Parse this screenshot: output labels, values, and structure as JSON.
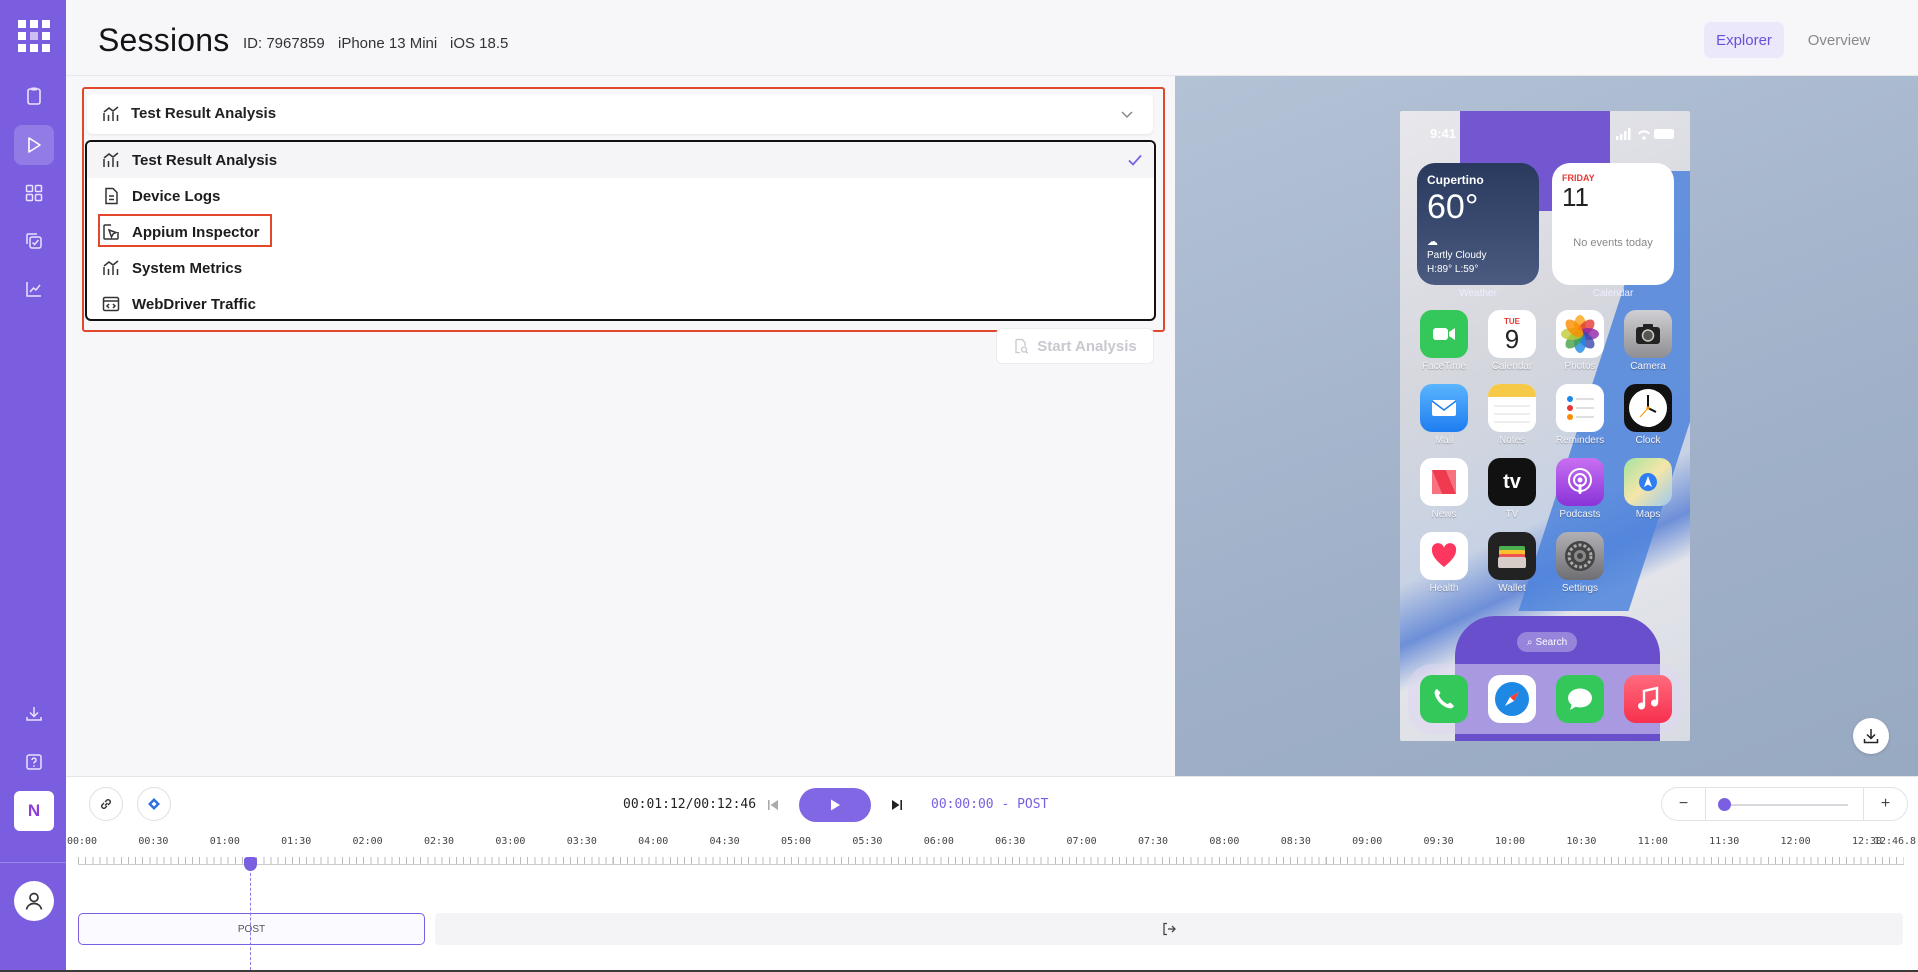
{
  "header": {
    "title": "Sessions",
    "id_text": "ID: 7967859",
    "device": "iPhone 13 Mini",
    "os": "iOS 18.5",
    "tabs": [
      "Explorer",
      "Overview"
    ],
    "active_tab": "Explorer"
  },
  "sidebar": {
    "items": [
      "clipboard-icon",
      "play-icon",
      "grid-icon",
      "copy-check-icon",
      "chart-icon",
      "download-icon",
      "help-icon"
    ],
    "active": "play-icon",
    "workspace_initial": "N"
  },
  "analysis": {
    "selected": "Test Result Analysis",
    "options": [
      {
        "label": "Test Result Analysis",
        "icon": "chart-up-icon",
        "selected": true
      },
      {
        "label": "Device Logs",
        "icon": "document-icon",
        "selected": false
      },
      {
        "label": "Appium Inspector",
        "icon": "cursor-select-icon",
        "selected": false
      },
      {
        "label": "System Metrics",
        "icon": "chart-up-icon",
        "selected": false
      },
      {
        "label": "WebDriver Traffic",
        "icon": "browser-code-icon",
        "selected": false
      }
    ],
    "start_button": "Start Analysis"
  },
  "device_screen": {
    "status_time": "9:41",
    "weather": {
      "city": "Cupertino",
      "temp": "60°",
      "condition": "Partly Cloudy",
      "range": "H:89° L:59°",
      "label": "Weather"
    },
    "calendar_widget": {
      "day": "FRIDAY",
      "date": "11",
      "events": "No events today",
      "label": "Calendar"
    },
    "apps": [
      {
        "name": "FaceTime",
        "color": "#34c759"
      },
      {
        "name": "Calendar",
        "color": "#ffffff"
      },
      {
        "name": "Photos",
        "color": "#ffffff"
      },
      {
        "name": "Camera",
        "color": "#8e8e93"
      },
      {
        "name": "Mail",
        "color": "#1e8cf0"
      },
      {
        "name": "Notes",
        "color": "#ffffff"
      },
      {
        "name": "Reminders",
        "color": "#ffffff"
      },
      {
        "name": "Clock",
        "color": "#111111"
      },
      {
        "name": "News",
        "color": "#ffffff"
      },
      {
        "name": "TV",
        "color": "#111111"
      },
      {
        "name": "Podcasts",
        "color": "#9b4ee0"
      },
      {
        "name": "Maps",
        "color": "#8fd18a"
      },
      {
        "name": "Health",
        "color": "#ffffff"
      },
      {
        "name": "Wallet",
        "color": "#222222"
      },
      {
        "name": "Settings",
        "color": "#8e8e93"
      }
    ],
    "calendar_app": {
      "day": "TUE",
      "date": "9"
    },
    "search": "Search",
    "dock": [
      "phone-icon",
      "safari-icon",
      "messages-icon",
      "music-icon"
    ]
  },
  "playback": {
    "timecode": "00:01:12/00:12:46",
    "position": "00:00:00 - POST",
    "zoom_level": 0.05
  },
  "timeline": {
    "ticks": [
      "00:00",
      "00:30",
      "01:00",
      "01:30",
      "02:00",
      "02:30",
      "03:00",
      "03:30",
      "04:00",
      "04:30",
      "05:00",
      "05:30",
      "06:00",
      "06:30",
      "07:00",
      "07:30",
      "08:00",
      "08:30",
      "09:00",
      "09:30",
      "10:00",
      "10:30",
      "11:00",
      "11:30",
      "12:00",
      "12:30",
      "12:46.8"
    ],
    "segment_label": "POST"
  },
  "colors": {
    "brand": "#7b5ee0",
    "highlight": "#e2472b",
    "accent": "#7a5fe0"
  }
}
